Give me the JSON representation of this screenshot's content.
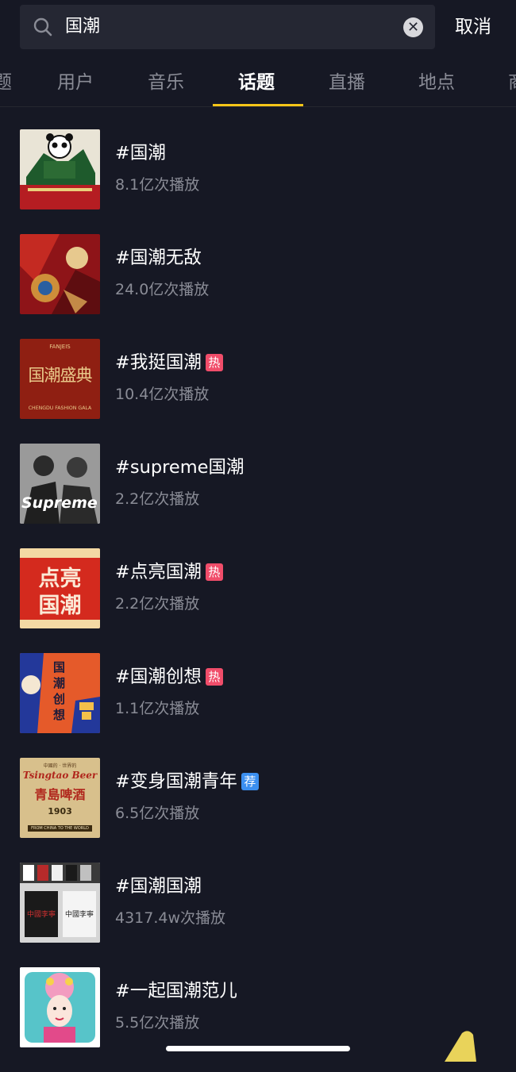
{
  "search": {
    "query": "国潮",
    "cancel_label": "取消"
  },
  "tabs": [
    {
      "label": "题"
    },
    {
      "label": "用户"
    },
    {
      "label": "音乐"
    },
    {
      "label": "话题"
    },
    {
      "label": "直播"
    },
    {
      "label": "地点"
    },
    {
      "label": "商"
    }
  ],
  "active_tab": "话题",
  "topics": [
    {
      "title": "#国潮",
      "plays": "8.1亿次播放",
      "badge": ""
    },
    {
      "title": "#国潮无敌",
      "plays": "24.0亿次播放",
      "badge": ""
    },
    {
      "title": "#我挺国潮",
      "plays": "10.4亿次播放",
      "badge": "热"
    },
    {
      "title": "#supreme国潮",
      "plays": "2.2亿次播放",
      "badge": ""
    },
    {
      "title": "#点亮国潮",
      "plays": "2.2亿次播放",
      "badge": "热"
    },
    {
      "title": "#国潮创想",
      "plays": "1.1亿次播放",
      "badge": "热"
    },
    {
      "title": "#变身国潮青年",
      "plays": "6.5亿次播放",
      "badge": "荐"
    },
    {
      "title": "#国潮国潮",
      "plays": "4317.4w次播放",
      "badge": ""
    },
    {
      "title": "#一起国潮范儿",
      "plays": "5.5亿次播放",
      "badge": ""
    }
  ],
  "thumb_texts": {
    "t3_top": "FANJEIS",
    "t3_main": "国潮盛典",
    "t3_sub": "CHENGDU FASHION GALA",
    "t4_main": "Supreme",
    "t5_l1": "点亮",
    "t5_l2": "国潮",
    "t6_main": "国潮创想",
    "t7_top": "中國的 · 世界的",
    "t7_brand": "Tsingtao Beer",
    "t7_cn": "青島啤酒",
    "t7_year": "1903",
    "t7_sub": "FROM CHINA TO THE WORLD",
    "t8_l": "中國李寧",
    "t8_r": "中國李寧"
  },
  "colors": {
    "background": "#161824",
    "accent": "#f5c518",
    "hot_badge": "#f04d6a",
    "rec_badge": "#3b8ff0",
    "muted_text": "#8a8c96"
  }
}
